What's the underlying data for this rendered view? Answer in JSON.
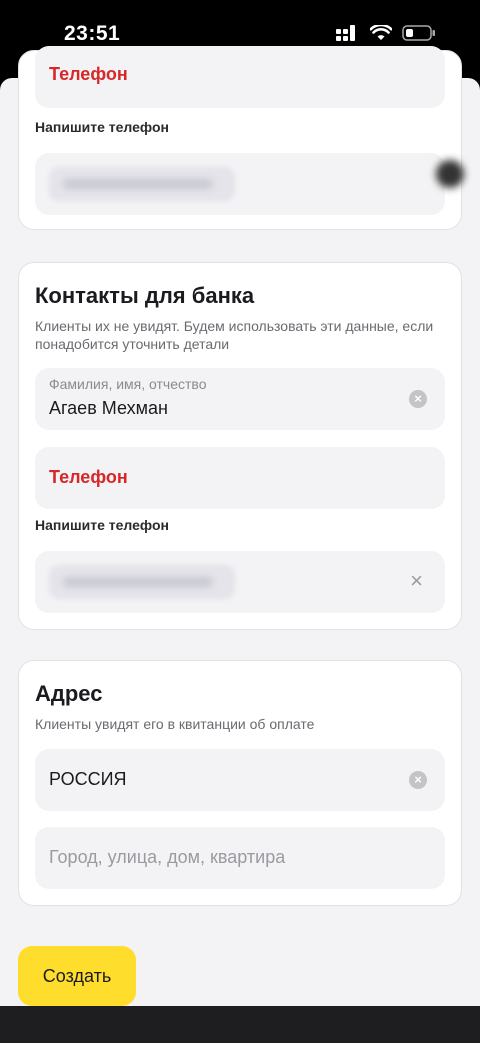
{
  "status_bar": {
    "time": "23:51"
  },
  "top_card": {
    "phone_error_label": "Телефон",
    "phone_hint": "Напишите телефон"
  },
  "bank_contacts": {
    "title": "Контакты для банка",
    "subtitle": "Клиенты их не увидят. Будем использовать эти данные, если понадобится уточнить детали",
    "full_name_label": "Фамилия, имя, отчество",
    "full_name_value": "Агаев Мехман",
    "phone_error_label": "Телефон",
    "phone_hint": "Напишите телефон"
  },
  "address": {
    "title": "Адрес",
    "subtitle": "Клиенты увидят его в квитанции об оплате",
    "country_value": "РОССИЯ",
    "street_placeholder": "Город, улица, дом, квартира"
  },
  "actions": {
    "create_label": "Создать"
  },
  "icons": {
    "clear": "clear-circle-icon",
    "close": "close-icon",
    "signal": "signal-icon",
    "wifi": "wifi-icon",
    "battery": "battery-icon"
  },
  "colors": {
    "accent": "#ffdd2d",
    "error": "#d62828",
    "background": "#f3f3f5"
  }
}
